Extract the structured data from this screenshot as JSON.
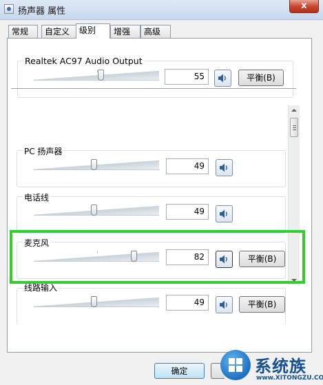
{
  "window": {
    "title": "扬声器 属性",
    "close_label": "x"
  },
  "tabs": [
    {
      "label": "常规",
      "active": false
    },
    {
      "label": "自定义",
      "active": false
    },
    {
      "label": "级别",
      "active": true
    },
    {
      "label": "增强",
      "active": false
    },
    {
      "label": "高级",
      "active": false
    }
  ],
  "main_control": {
    "label": "Realtek AC97 Audio Output",
    "value": "55",
    "balance_label": "平衡(B)"
  },
  "channels": [
    {
      "label": "PC 扬声器",
      "value": "49",
      "balance_label": ""
    },
    {
      "label": "电话线",
      "value": "49",
      "balance_label": ""
    },
    {
      "label": "麦克风",
      "value": "82",
      "balance_label": "平衡(B)"
    },
    {
      "label": "线路输入",
      "value": "49",
      "balance_label": "平衡(B)"
    }
  ],
  "footer": {
    "ok_label": "确定"
  },
  "watermark": {
    "text": "系统族",
    "url": "www.XITONGZU.COM"
  },
  "colors": {
    "highlight": "#34cc2e",
    "close": "#c7432a",
    "panel_border": "#8e9bab"
  }
}
